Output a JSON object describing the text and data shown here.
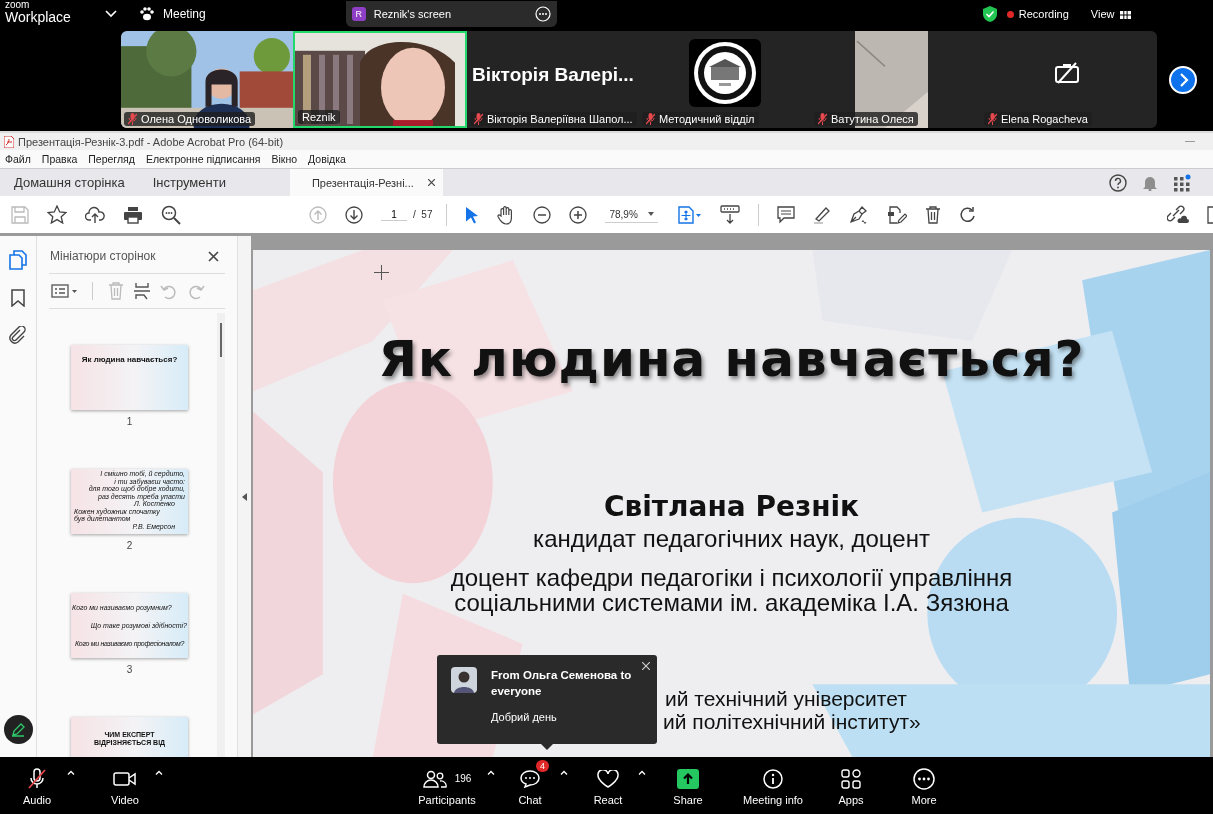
{
  "top_bar": {
    "logo_top": "zoom",
    "logo_bottom": "Workplace",
    "meeting": "Meeting",
    "share_pill": {
      "avatar": "R",
      "label": "Reznik's screen"
    },
    "recording": "Recording",
    "view": "View"
  },
  "gallery": [
    {
      "kind": "video",
      "name": "Олена Одноволикова",
      "muted": true,
      "speaking": false
    },
    {
      "kind": "video2",
      "name": "Reznik",
      "muted": false,
      "speaking": true
    },
    {
      "kind": "name",
      "display": "Вікторія  Валері...",
      "name": "Вікторія Валеріївна Шапол...",
      "muted": true,
      "speaking": false
    },
    {
      "kind": "avatar",
      "name": "Методичний відділ",
      "muted": true,
      "speaking": false
    },
    {
      "kind": "video3",
      "name": "Ватутина Олеся",
      "muted": true,
      "speaking": false
    },
    {
      "kind": "camera_off",
      "name": "Elena Rogacheva",
      "muted": true,
      "speaking": false
    }
  ],
  "acrobat": {
    "title": "Презентація-Резнік-3.pdf - Adobe Acrobat Pro (64-bit)",
    "menu": [
      "Файл",
      "Правка",
      "Перегляд",
      "Електронне підписання",
      "Вікно",
      "Довідка"
    ],
    "tabs": [
      {
        "label": "Домашня сторінка",
        "kind": "home",
        "selected": false
      },
      {
        "label": "Інструменти",
        "kind": "home",
        "selected": false
      },
      {
        "label": "Презентація-Резні...",
        "kind": "document",
        "selected": true
      }
    ],
    "toolbar": {
      "page": "1",
      "page_total": "/  57",
      "zoom": "78,9%"
    }
  },
  "thumbnails": {
    "title": "Мініатюри сторінок",
    "pages": [
      {
        "number": "1",
        "texts": [
          {
            "kind": "title",
            "text": "Як людина навчається?"
          }
        ]
      },
      {
        "number": "2",
        "texts": [
          {
            "kind": "right",
            "text": "І смішно тобі, й сердито,"
          },
          {
            "kind": "right",
            "text": "і ти забуваєш часто:"
          },
          {
            "kind": "right",
            "text": "для того щоб добре ходити,"
          },
          {
            "kind": "right",
            "text": "раз десять треба упасти"
          },
          {
            "kind": "sign",
            "text": "Л. Костенко"
          },
          {
            "kind": "left",
            "text": "Кожен художник спочатку"
          },
          {
            "kind": "left",
            "text": "був дилетантом"
          },
          {
            "kind": "sign",
            "text": "Р.В. Емерсон"
          }
        ]
      },
      {
        "number": "3",
        "texts": [
          {
            "kind": "left",
            "text": "Кого ми називаємо розумним?"
          },
          {
            "kind": "right",
            "text": "Що таке розумові здібності?"
          },
          {
            "kind": "center",
            "text": "Кого ми називаємо професіоналом?"
          }
        ]
      },
      {
        "texts": [
          {
            "kind": "caps",
            "text": "ЧИМ ЕКСПЕРТ"
          },
          {
            "kind": "caps",
            "text": "ВІДРІЗНЯЄТЬСЯ ВІД"
          }
        ]
      }
    ]
  },
  "slide": {
    "title": "Як людина навчається?",
    "author": "Світлана Резнік",
    "lines": [
      "кандидат педагогічних наук, доцент",
      "доцент кафедри педагогіки і психології управління",
      "соціальними системами ім. академіка І.А. Зязюна"
    ],
    "partial_lines": [
      "ий технічний університет",
      "ий політехнічний інститут»"
    ]
  },
  "chat_popup": {
    "from": "From Ольга Семенова to everyone",
    "message": "Добрий день"
  },
  "bottom_bar": [
    {
      "kind": "audio",
      "label": "Audio",
      "muted": true
    },
    {
      "kind": "video",
      "label": "Video"
    },
    {
      "kind": "participants",
      "label": "Participants",
      "count": "196"
    },
    {
      "kind": "chat",
      "label": "Chat",
      "badge": "4"
    },
    {
      "kind": "react",
      "label": "React"
    },
    {
      "kind": "share",
      "label": "Share"
    },
    {
      "kind": "info",
      "label": "Meeting info"
    },
    {
      "kind": "apps",
      "label": "Apps"
    },
    {
      "kind": "more",
      "label": "More"
    }
  ]
}
